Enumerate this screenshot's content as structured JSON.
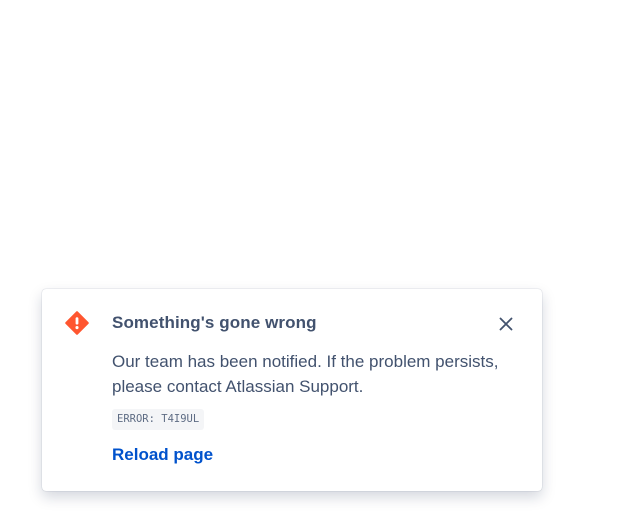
{
  "flag": {
    "title": "Something's gone wrong",
    "description": "Our team has been notified. If the problem persists, please contact Atlassian Support.",
    "error_code": "ERROR: T4I9UL",
    "action_label": "Reload page",
    "icon": "error-icon",
    "close_icon": "close-icon"
  },
  "colors": {
    "error_icon": "#ff5630",
    "title_text": "#42526e",
    "body_text": "#42526e",
    "link": "#0052cc",
    "code_background": "#f4f5f7",
    "code_text": "#5e6c84"
  }
}
